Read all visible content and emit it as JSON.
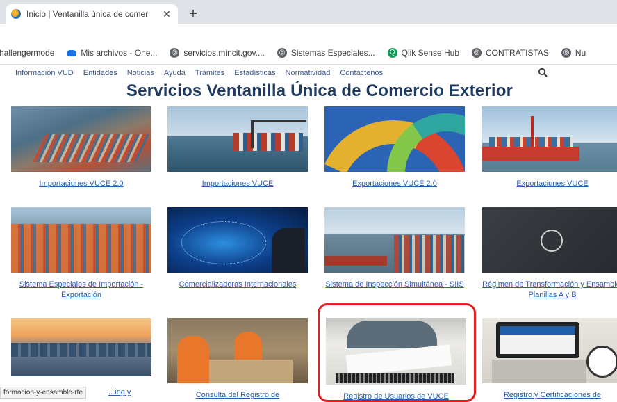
{
  "browser": {
    "tab_title": "Inicio | Ventanilla única de comer",
    "tab_close": "✕",
    "new_tab": "+",
    "bookmarks": [
      {
        "label": "hallengermode",
        "icon": "none"
      },
      {
        "label": "Mis archivos - One...",
        "icon": "cloud-icon"
      },
      {
        "label": "servicios.mincit.gov....",
        "icon": "globe-icon"
      },
      {
        "label": "Sistemas Especiales...",
        "icon": "globe-icon"
      },
      {
        "label": "Qlik Sense Hub",
        "icon": "qlik-icon"
      },
      {
        "label": "CONTRATISTAS",
        "icon": "globe-icon"
      },
      {
        "label": "Nu",
        "icon": "globe-icon"
      }
    ]
  },
  "site": {
    "nav": [
      "Información VUD",
      "Entidades",
      "Noticias",
      "Ayuda",
      "Trámites",
      "Estadísticas",
      "Normatividad",
      "Contáctenos"
    ],
    "search_icon": "🔍",
    "title": "Servicios Ventanilla Única de Comercio Exterior",
    "cards": [
      {
        "label": "Importaciones VUCE 2.0",
        "image": "port-aerial"
      },
      {
        "label": "Importaciones VUCE",
        "image": "ship-crane"
      },
      {
        "label": "Exportaciones VUCE 2.0",
        "image": "colorful-containers"
      },
      {
        "label": "Exportaciones VUCE",
        "image": "cargo-ship"
      },
      {
        "label": "Sistema Especiales de Importación - Exportación",
        "image": "container-yard"
      },
      {
        "label": "Comercializadoras Internacionales",
        "image": "digital-globe"
      },
      {
        "label": "Sistema de Inspección Simultánea - SIIS",
        "image": "port-city"
      },
      {
        "label": "Régimen de Transformación y Ensamble, Planillas A y B",
        "image": "dark-video"
      },
      {
        "label": "...ing y",
        "image": "sunset-containers"
      },
      {
        "label": "Consulta del Registro de",
        "image": "factory-workers"
      },
      {
        "label": "Registro de Usuarios de VUCE",
        "image": "signing-document"
      },
      {
        "label": "Registro y Certificaciones de",
        "image": "laptop-typing"
      }
    ]
  },
  "status_bar": "formacion-y-ensamble-rte",
  "colors": {
    "highlight": "#e41e1e",
    "title": "#1f3a5f",
    "link": "#2a5db0"
  }
}
